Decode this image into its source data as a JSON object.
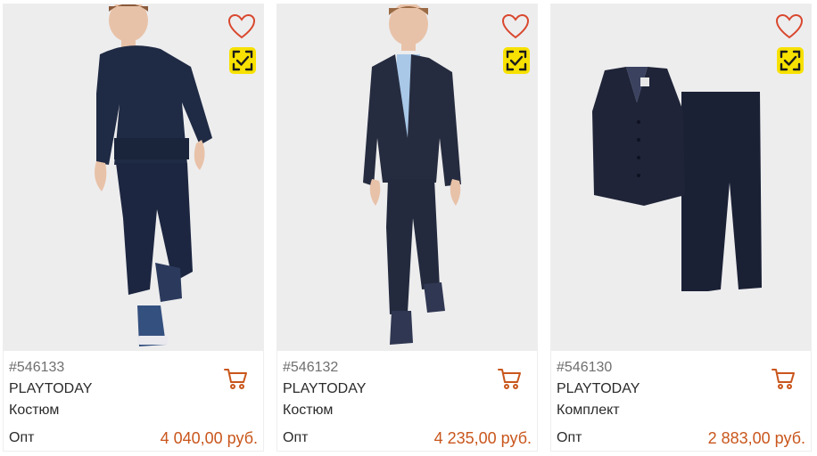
{
  "colors": {
    "accent": "#c9561c",
    "heart": "#d9482e",
    "scan_badge": "#f7e100"
  },
  "icons": {
    "favorite": "heart-outline-icon",
    "scan": "scan-check-icon",
    "cart": "shopping-cart-icon"
  },
  "products": [
    {
      "article": "#546133",
      "brand": "PLAYTODAY",
      "type": "Костюм",
      "price_label": "Опт",
      "price": "4 040,00 руб."
    },
    {
      "article": "#546132",
      "brand": "PLAYTODAY",
      "type": "Костюм",
      "price_label": "Опт",
      "price": "4 235,00 руб."
    },
    {
      "article": "#546130",
      "brand": "PLAYTODAY",
      "type": "Комплект",
      "price_label": "Опт",
      "price": "2 883,00 руб."
    }
  ]
}
